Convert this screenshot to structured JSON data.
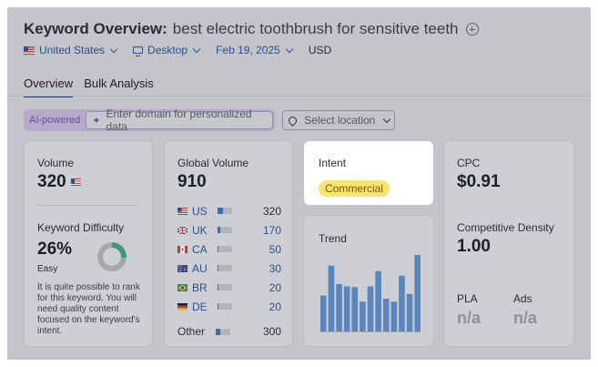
{
  "header": {
    "title_label": "Keyword Overview:",
    "keyword": "best electric toothbrush for sensitive teeth",
    "filters": {
      "country": "United States",
      "device": "Desktop",
      "date": "Feb 19, 2025",
      "currency": "USD"
    }
  },
  "tabs": [
    {
      "label": "Overview",
      "active": true
    },
    {
      "label": "Bulk Analysis",
      "active": false
    }
  ],
  "ai_bar": {
    "badge": "AI-powered",
    "domain_placeholder": "Enter domain for personalized data",
    "location_placeholder": "Select location"
  },
  "volume": {
    "label": "Volume",
    "value": "320"
  },
  "keyword_difficulty": {
    "label": "Keyword Difficulty",
    "value": "26%",
    "level": "Easy",
    "percent": 26,
    "description": "It is quite possible to rank for this keyword. You will need quality content focused on the keyword's intent."
  },
  "global_volume": {
    "label": "Global Volume",
    "value": "910",
    "countries": [
      {
        "code": "US",
        "value": "320",
        "share": 0.35,
        "flag": "us-flag",
        "link": false
      },
      {
        "code": "UK",
        "value": "170",
        "share": 0.19,
        "flag": "uk-flag",
        "link": true
      },
      {
        "code": "CA",
        "value": "50",
        "share": 0.06,
        "flag": "ca-flag",
        "link": true
      },
      {
        "code": "AU",
        "value": "30",
        "share": 0.04,
        "flag": "au-flag",
        "link": true
      },
      {
        "code": "BR",
        "value": "20",
        "share": 0.03,
        "flag": "br-flag",
        "link": true
      },
      {
        "code": "DE",
        "value": "20",
        "share": 0.03,
        "flag": "de-flag",
        "link": true
      }
    ],
    "other": {
      "label": "Other",
      "value": "300",
      "share": 0.33
    }
  },
  "intent": {
    "label": "Intent",
    "value": "Commercial",
    "badge_color": "#fbe56f"
  },
  "trend": {
    "label": "Trend",
    "values": [
      0.47,
      0.86,
      0.62,
      0.59,
      0.58,
      0.39,
      0.59,
      0.79,
      0.43,
      0.39,
      0.73,
      0.49,
      1.0
    ]
  },
  "cpc": {
    "label": "CPC",
    "value": "$0.91"
  },
  "competitive_density": {
    "label": "Competitive Density",
    "value": "1.00"
  },
  "pla": {
    "label": "PLA",
    "value": "n/a"
  },
  "ads": {
    "label": "Ads",
    "value": "n/a"
  },
  "colors": {
    "accent": "#2d4e87",
    "bar": "#5a86bd",
    "kd_green": "#3a9a78"
  }
}
